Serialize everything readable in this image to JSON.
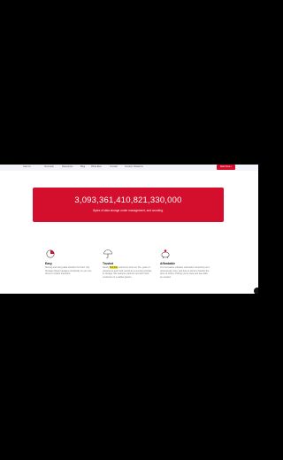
{
  "nav": {
    "logo_text": "Gait Co",
    "links": [
      "Overview",
      "Resources",
      "Blog",
      "What Else",
      "Contact",
      "Investor Relations"
    ],
    "cta_label": "Start Free ›"
  },
  "banner": {
    "number": "3,093,361,410,821,330,000",
    "subtitle": "Bytes of data storage under management, and counting."
  },
  "features": [
    {
      "title": "Easy",
      "text": "Storing and using data shouldn't be hard. Our Storage Cloud manages complexity so you can focus on what's important.",
      "icon": "pie-chart-icon"
    },
    {
      "title": "Trusted",
      "text_before": "Nearly ",
      "highlight": "500,000",
      "text_after": " customers trust our 15+ years of experience and track record as a security provider in storage. We welcome partners and don't lock customers in a walled garden.",
      "icon": "umbrella-icon"
    },
    {
      "title": "Affordable",
      "text": "Our innovative software eliminates complexity and unnecessary fees, and lets us sell at a fraction the price of others. Pricing you're clear and see data as needed.",
      "icon": "piggy-bank-icon"
    }
  ],
  "colors": {
    "brand_red": "#d40f2e",
    "highlight": "#f0ef2a"
  }
}
